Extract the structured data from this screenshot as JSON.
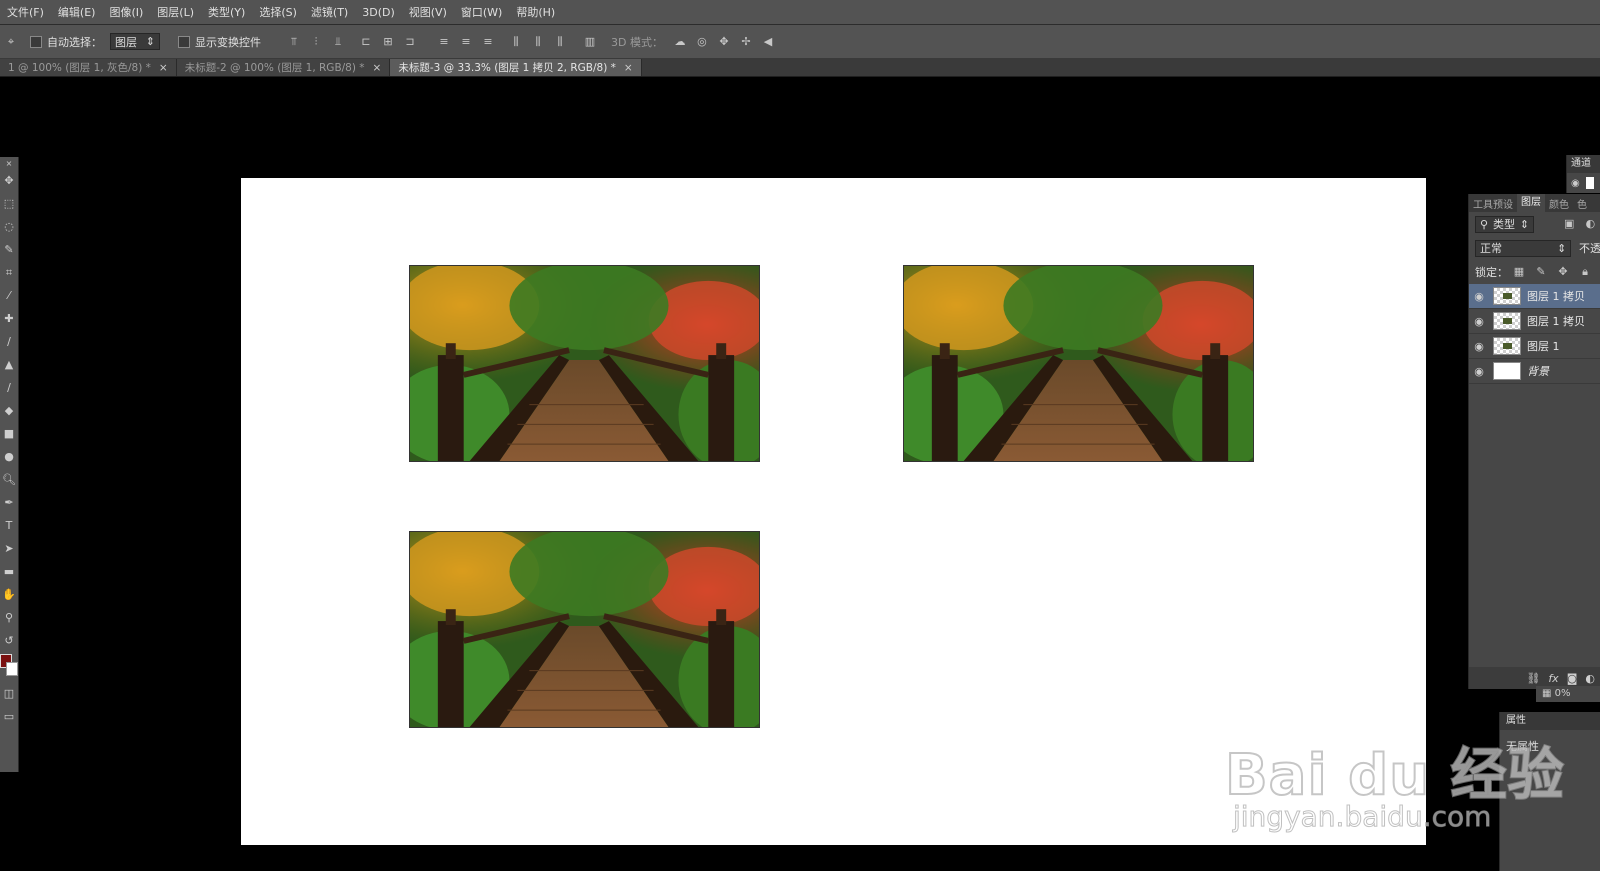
{
  "menu": [
    "文件(F)",
    "编辑(E)",
    "图像(I)",
    "图层(L)",
    "类型(Y)",
    "选择(S)",
    "滤镜(T)",
    "3D(D)",
    "视图(V)",
    "窗口(W)",
    "帮助(H)"
  ],
  "options": {
    "auto_select_label": "自动选择：",
    "auto_select_value": "图层",
    "show_transform_label": "显示变换控件",
    "mode_3d_label": "3D 模式："
  },
  "tabs": [
    {
      "label": "1 @ 100% (图层 1, 灰色/8) *",
      "active": false
    },
    {
      "label": "未标题-2 @ 100% (图层 1, RGB/8) *",
      "active": false
    },
    {
      "label": "未标题-3 @ 33.3% (图层 1 拷贝 2, RGB/8) *",
      "active": true
    }
  ],
  "tab_close": "×",
  "channels_panel": {
    "title": "通道"
  },
  "layers_panel": {
    "tabs": [
      "工具预设",
      "图层",
      "颜色",
      "色"
    ],
    "filter_label": "类型",
    "blend_mode": "正常",
    "opacity_label": "不透",
    "lock_label": "锁定：",
    "layers": [
      {
        "name": "图层 1 拷贝",
        "selected": true
      },
      {
        "name": "图层 1 拷贝",
        "selected": false
      },
      {
        "name": "图层 1",
        "selected": false
      },
      {
        "name": "背景",
        "selected": false
      }
    ],
    "footer_icons": [
      "link-icon",
      "fx-icon",
      "mask-icon",
      "adjustment-icon"
    ]
  },
  "fill_row": "0%",
  "properties_panel": {
    "title": "属性",
    "body": "无属性"
  },
  "watermark": {
    "main": "Bai du 经验",
    "url": "jingyan.baidu.com"
  }
}
